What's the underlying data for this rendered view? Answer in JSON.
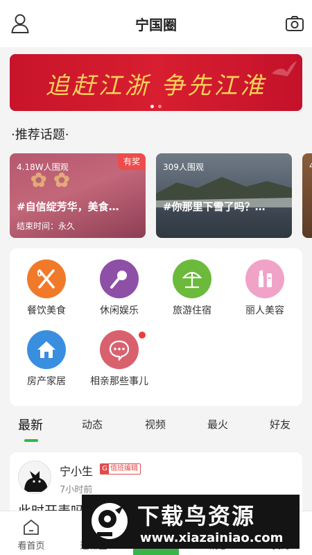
{
  "header": {
    "title": "宁国圈",
    "left_icon": "user-icon",
    "right_icon": "camera-icon"
  },
  "banner": {
    "slogan": "追赶江浙  争先江淮",
    "slide_count": 2,
    "active_slide": 1
  },
  "section": {
    "title": "·推荐话题·"
  },
  "topics": [
    {
      "views": "4.18W人围观",
      "name": "#自信绽芳华，美食…",
      "end_time": "结束时间：永久",
      "badge": "有奖"
    },
    {
      "views": "309人围观",
      "name": "#你那里下雪了吗？…"
    },
    {
      "views": "4"
    }
  ],
  "categories": [
    {
      "label": "餐饮美食",
      "icon": "fork-knife-icon",
      "color": "#f07a2a"
    },
    {
      "label": "休闲娱乐",
      "icon": "microphone-icon",
      "color": "#8e4fa6"
    },
    {
      "label": "旅游住宿",
      "icon": "umbrella-icon",
      "color": "#6cba3c"
    },
    {
      "label": "丽人美容",
      "icon": "cosmetics-icon",
      "color": "#f0a3c7"
    },
    {
      "label": "房产家居",
      "icon": "house-icon",
      "color": "#3a8ee0"
    },
    {
      "label": "相亲那些事儿",
      "icon": "chat-bubble-icon",
      "color": "#d9616e",
      "has_badge": true
    }
  ],
  "tabs": [
    {
      "label": "最新",
      "active": true
    },
    {
      "label": "动态"
    },
    {
      "label": "视频"
    },
    {
      "label": "最火"
    },
    {
      "label": "好友"
    }
  ],
  "post": {
    "username": "宁小生",
    "badge": "值班编辑",
    "badge_prefix": "G",
    "time": "7小时前",
    "text": "此时开表吗"
  },
  "bottom_nav": [
    {
      "label": "看首页",
      "icon": "home-icon"
    },
    {
      "label": "逛社区",
      "icon": "community-icon"
    },
    {
      "label": "",
      "icon": "plus-icon"
    },
    {
      "label": "消息",
      "icon": "message-icon"
    },
    {
      "label": "我的",
      "icon": "profile-icon"
    }
  ],
  "watermark": {
    "title": "下载鸟资源",
    "url": "www.xiazainiao.com"
  },
  "colors": {
    "accent": "#3ab44a",
    "banner": "#d01c2e",
    "award": "#ee4c4c"
  }
}
